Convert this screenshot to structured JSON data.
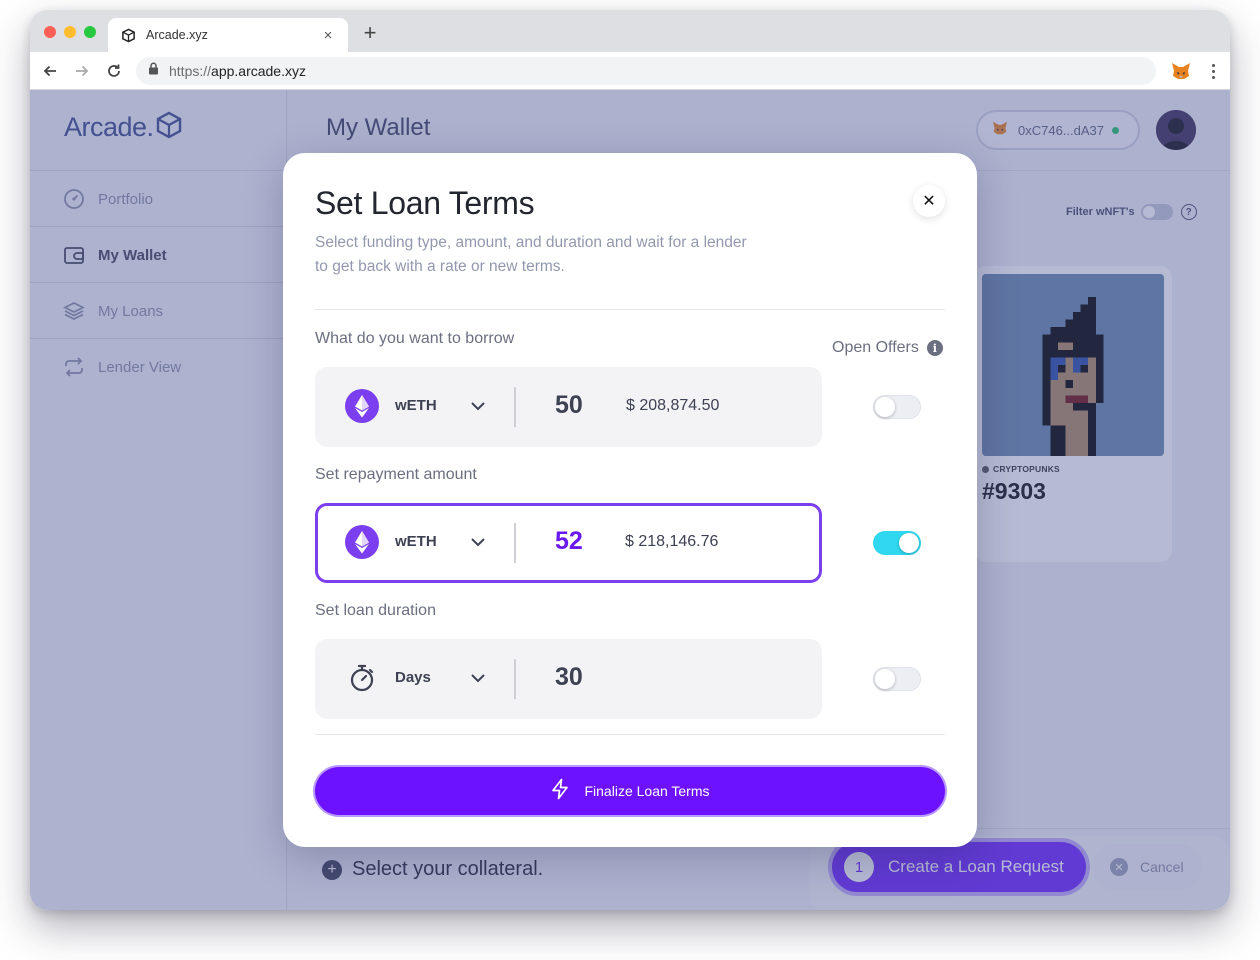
{
  "browser": {
    "tab_title": "Arcade.xyz",
    "new_tab": "+",
    "tab_close": "×",
    "url_scheme": "https://",
    "url_host": "app.arcade.xyz"
  },
  "app": {
    "logo_text": "Arcade.",
    "page_title": "My Wallet",
    "sidebar": {
      "items": [
        {
          "label": "Portfolio",
          "icon": "gauge-icon"
        },
        {
          "label": "My Wallet",
          "icon": "wallet-icon"
        },
        {
          "label": "My Loans",
          "icon": "layers-icon"
        },
        {
          "label": "Lender View",
          "icon": "repeat-icon"
        }
      ]
    },
    "wallet": {
      "address": "0xC746...dA37"
    },
    "filter": {
      "label": "Filter wNFT's",
      "help": "?"
    },
    "nft": {
      "collection": "CRYPTOPUNKS",
      "id": "#9303"
    },
    "bottom": {
      "collateral_prompt": "Select your collateral.",
      "step": "1",
      "create_label": "Create a Loan Request",
      "cancel_label": "Cancel"
    }
  },
  "modal": {
    "title": "Set Loan Terms",
    "close": "✕",
    "subtitle": "Select funding type, amount, and duration and wait for a lender to get back with a rate or new terms.",
    "open_offers_label": "Open Offers",
    "info": "i",
    "borrow": {
      "label": "What do you want to borrow",
      "token": "wETH",
      "amount": "50",
      "usd": "$ 208,874.50",
      "open_offer": false
    },
    "repayment": {
      "label": "Set repayment amount",
      "token": "wETH",
      "amount": "52",
      "usd": "$ 218,146.76",
      "open_offer": true
    },
    "duration": {
      "label": "Set loan duration",
      "unit": "Days",
      "amount": "30",
      "open_offer": false
    },
    "finalize_label": "Finalize Loan Terms"
  },
  "colors": {
    "accent": "#6d12ff",
    "toggle_on": "#2fd7ef",
    "overlay": "#525a96",
    "status_online": "#24c16b"
  }
}
